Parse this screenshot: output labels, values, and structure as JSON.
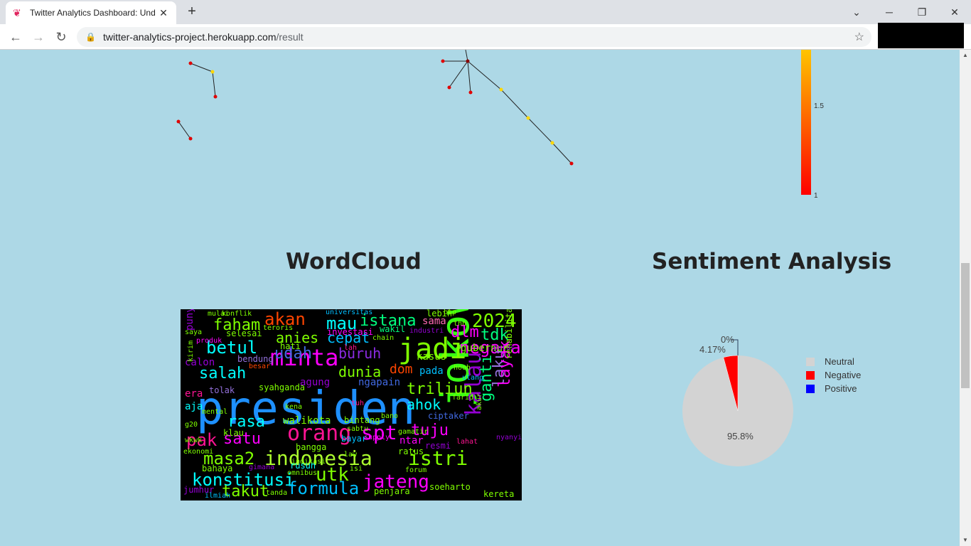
{
  "browser": {
    "tab_title": "Twitter Analytics Dashboard: Und",
    "url_host": "twitter-analytics-project.herokuapp.com",
    "url_path": "/result"
  },
  "network_graph": {
    "colorbar": {
      "tick_top": "1.5",
      "tick_bottom": "1",
      "colors": [
        "#ffd000",
        "#ff0000"
      ]
    }
  },
  "wordcloud": {
    "title": "WordCloud",
    "words": [
      {
        "t": "presiden",
        "c": "#1e90ff"
      },
      {
        "t": "jokowi",
        "c": "#39ff14"
      },
      {
        "t": "jadi",
        "c": "#7fff00"
      },
      {
        "t": "minta",
        "c": "#ff00ff"
      },
      {
        "t": "orang",
        "c": "#ff1493"
      },
      {
        "t": "indonesia",
        "c": "#adff2f"
      },
      {
        "t": "2024",
        "c": "#7fff00"
      },
      {
        "t": "spt",
        "c": "#ff00ff"
      },
      {
        "t": "istri",
        "c": "#7fff00"
      },
      {
        "t": "jateng",
        "c": "#ff00ff"
      },
      {
        "t": "kalau",
        "c": "#9400d3"
      },
      {
        "t": "konstitusi",
        "c": "#00ffff"
      },
      {
        "t": "masa2",
        "c": "#7fff00"
      },
      {
        "t": "formula",
        "c": "#00bfff"
      },
      {
        "t": "betul",
        "c": "#00ffff"
      },
      {
        "t": "akan",
        "c": "#ff4500"
      },
      {
        "t": "salah",
        "c": "#00ffff"
      },
      {
        "t": "udah",
        "c": "#4169e1"
      },
      {
        "t": "istana",
        "c": "#00ff7f"
      },
      {
        "t": "mau",
        "c": "#00ffff"
      },
      {
        "t": "faham",
        "c": "#7fff00"
      },
      {
        "t": "anies",
        "c": "#7fff00"
      },
      {
        "t": "cepat",
        "c": "#00bfff"
      },
      {
        "t": "negara",
        "c": "#ff00ff"
      },
      {
        "t": "dlm",
        "c": "#ff00ff"
      },
      {
        "t": "tdk",
        "c": "#00ff7f"
      },
      {
        "t": "buruh",
        "c": "#8a2be2"
      },
      {
        "t": "dunia",
        "c": "#7fff00"
      },
      {
        "t": "dom",
        "c": "#ff4500"
      },
      {
        "t": "triliun",
        "c": "#7fff00"
      },
      {
        "t": "ahok",
        "c": "#00ffff"
      },
      {
        "t": "tuju",
        "c": "#ff00ff"
      },
      {
        "t": "rasa",
        "c": "#00ffff"
      },
      {
        "t": "satu",
        "c": "#ff00ff"
      },
      {
        "t": "pak",
        "c": "#ff1493"
      },
      {
        "t": "utk",
        "c": "#7fff00"
      },
      {
        "t": "takut",
        "c": "#7fff00"
      },
      {
        "t": "ganti",
        "c": "#00ff7f"
      },
      {
        "t": "laku",
        "c": "#9370db"
      },
      {
        "t": "layak",
        "c": "#ff00ff"
      },
      {
        "t": "sama",
        "c": "#ff69b4"
      },
      {
        "t": "lebih",
        "c": "#7fff00"
      },
      {
        "t": "gubernur",
        "c": "#7fff00"
      },
      {
        "t": "kasus",
        "c": "#7fff00"
      },
      {
        "t": "pada",
        "c": "#00bfff"
      },
      {
        "t": "walikota",
        "c": "#7fff00"
      },
      {
        "t": "ngapain",
        "c": "#4169e1"
      },
      {
        "t": "agung",
        "c": "#9400d3"
      },
      {
        "t": "calon",
        "c": "#9400d3"
      },
      {
        "t": "bendung",
        "c": "#9370db"
      },
      {
        "t": "syahganda",
        "c": "#7fff00"
      },
      {
        "t": "era",
        "c": "#ff1493"
      },
      {
        "t": "aja",
        "c": "#00ffff"
      },
      {
        "t": "punya",
        "c": "#9400d3"
      },
      {
        "t": "selesai",
        "c": "#7fff00"
      },
      {
        "t": "investasi",
        "c": "#ff00ff"
      },
      {
        "t": "wakil",
        "c": "#00ff7f"
      },
      {
        "t": "tolak",
        "c": "#9370db"
      },
      {
        "t": "bintang",
        "c": "#7fff00"
      },
      {
        "t": "bayar",
        "c": "#00bfff"
      },
      {
        "t": "ntar",
        "c": "#ff00ff"
      },
      {
        "t": "klau",
        "c": "#7fff00"
      },
      {
        "t": "bangga",
        "c": "#7fff00"
      },
      {
        "t": "ciptaker",
        "c": "#4169e1"
      },
      {
        "t": "resmi",
        "c": "#9400d3"
      },
      {
        "t": "ratus",
        "c": "#7fff00"
      },
      {
        "t": "rusuh",
        "c": "#00ffff"
      },
      {
        "t": "penjara",
        "c": "#7fff00"
      },
      {
        "t": "kereta",
        "c": "#7fff00"
      },
      {
        "t": "rehabilitasi",
        "c": "#7fff00"
      },
      {
        "t": "soeharto",
        "c": "#7fff00"
      },
      {
        "t": "bahaya",
        "c": "#7fff00"
      },
      {
        "t": "ekonomi",
        "c": "#7fff00"
      },
      {
        "t": "wkwk",
        "c": "#7fff00"
      },
      {
        "t": "jumhur",
        "c": "#9400d3"
      },
      {
        "t": "ilmiah",
        "c": "#00bfff"
      },
      {
        "t": "tanda",
        "c": "#7fff00"
      },
      {
        "t": "konflik",
        "c": "#7fff00"
      },
      {
        "t": "universitas",
        "c": "#00bfff"
      },
      {
        "t": "mulai",
        "c": "#7fff00"
      },
      {
        "t": "saya",
        "c": "#7fff00"
      },
      {
        "t": "produk",
        "c": "#ff00ff"
      },
      {
        "t": "hati",
        "c": "#7fff00"
      },
      {
        "t": "besar",
        "c": "#ff4500"
      },
      {
        "t": "kirim",
        "c": "#7fff00"
      },
      {
        "t": "gimana",
        "c": "#9400d3"
      },
      {
        "t": "omnibus",
        "c": "#7fff00"
      },
      {
        "t": "forum",
        "c": "#7fff00"
      },
      {
        "t": "industri",
        "c": "#9400d3"
      },
      {
        "t": "lah",
        "c": "#ff1493"
      },
      {
        "t": "chain",
        "c": "#7fff00"
      },
      {
        "t": "utang",
        "c": "#00bfff"
      },
      {
        "t": "hooh",
        "c": "#7fff00"
      },
      {
        "t": "farid",
        "c": "#7fff00"
      },
      {
        "t": "supply",
        "c": "#ff00ff"
      },
      {
        "t": "law",
        "c": "#7fff00"
      },
      {
        "t": "sabtu",
        "c": "#7fff00"
      },
      {
        "t": "isi",
        "c": "#7fff00"
      },
      {
        "t": "lahat",
        "c": "#ff1493"
      },
      {
        "t": "thn",
        "c": "#7fff00"
      },
      {
        "t": "tuh",
        "c": "#ff1493"
      },
      {
        "t": "bano",
        "c": "#7fff00"
      },
      {
        "t": "gamatir",
        "c": "#7fff00"
      },
      {
        "t": "g20",
        "c": "#7fff00"
      },
      {
        "t": "teroris",
        "c": "#7fff00"
      },
      {
        "t": "indikasi",
        "c": "#7fff00"
      },
      {
        "t": "akur",
        "c": "#7fff00"
      },
      {
        "t": "nyanyi",
        "c": "#9400d3"
      },
      {
        "t": "btp",
        "c": "#7fff00"
      },
      {
        "t": "putus",
        "c": "#9400d3"
      },
      {
        "t": "mental",
        "c": "#7fff00"
      },
      {
        "t": "kena",
        "c": "#7fff00"
      }
    ]
  },
  "sentiment": {
    "title": "Sentiment Analysis",
    "labels": {
      "neutral_pct": "95.8%",
      "negative_pct": "4.17%",
      "positive_pct": "0%"
    },
    "legend": [
      {
        "name": "Neutral",
        "color": "#d3d3d3"
      },
      {
        "name": "Negative",
        "color": "#ff0000"
      },
      {
        "name": "Positive",
        "color": "#0000ff"
      }
    ],
    "chart_data": {
      "type": "pie",
      "categories": [
        "Neutral",
        "Negative",
        "Positive"
      ],
      "values": [
        95.8,
        4.17,
        0
      ],
      "colors": [
        "#d3d3d3",
        "#ff0000",
        "#0000ff"
      ]
    }
  }
}
